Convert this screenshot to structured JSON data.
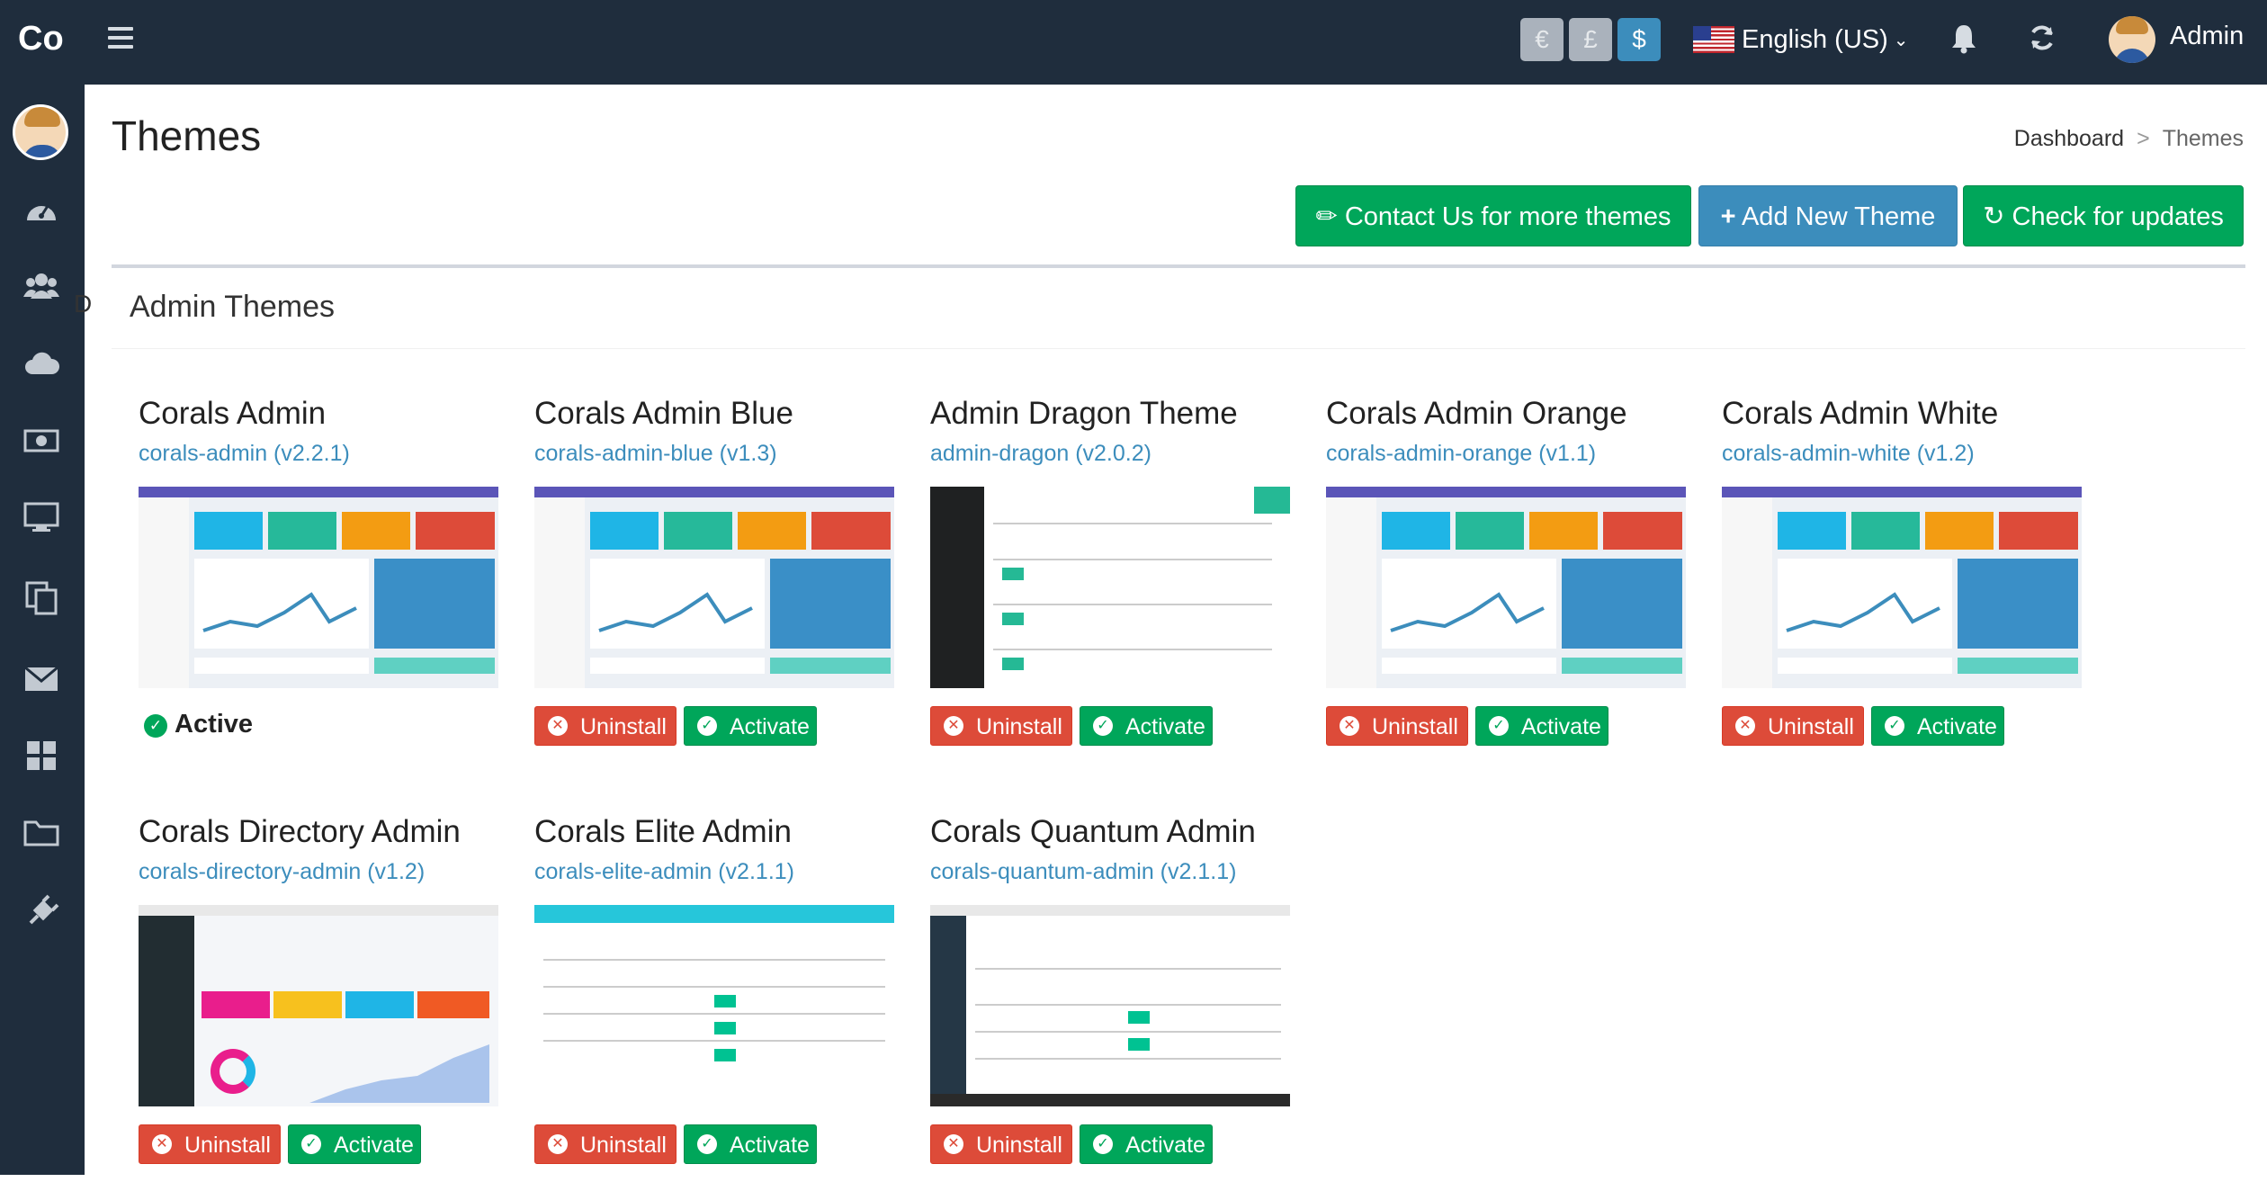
{
  "app": {
    "brand": "Co"
  },
  "topbar": {
    "currencies": [
      {
        "symbol": "€",
        "active": false
      },
      {
        "symbol": "£",
        "active": false
      },
      {
        "symbol": "$",
        "active": true
      }
    ],
    "language": "English (US)",
    "user_name": "Admin",
    "icons": [
      "menu-icon",
      "bell-icon",
      "refresh-icon",
      "avatar"
    ]
  },
  "sidebar": {
    "peek_label": "D",
    "icons": [
      "dashboard-icon",
      "users-icon",
      "cloud-icon",
      "money-icon",
      "desktop-icon",
      "copy-icon",
      "envelope-icon",
      "th-large-icon",
      "folder-icon",
      "plug-icon"
    ]
  },
  "page": {
    "title": "Themes",
    "breadcrumb": {
      "home": "Dashboard",
      "separator": ">",
      "current": "Themes"
    }
  },
  "header_buttons": {
    "contact": "Contact Us for more themes",
    "add": "Add New Theme",
    "check": "Check for updates"
  },
  "box": {
    "title": "Admin Themes"
  },
  "actions": {
    "uninstall": "Uninstall",
    "activate": "Activate",
    "active": "Active"
  },
  "themes": [
    {
      "name": "Corals Admin",
      "slug": "corals-admin (v2.2.1)",
      "active": true
    },
    {
      "name": "Corals Admin Blue",
      "slug": "corals-admin-blue (v1.3)",
      "active": false
    },
    {
      "name": "Admin Dragon Theme",
      "slug": "admin-dragon (v2.0.2)",
      "active": false
    },
    {
      "name": "Corals Admin Orange",
      "slug": "corals-admin-orange (v1.1)",
      "active": false
    },
    {
      "name": "Corals Admin White",
      "slug": "corals-admin-white (v1.2)",
      "active": false
    },
    {
      "name": "Corals Directory Admin",
      "slug": "corals-directory-admin (v1.2)",
      "active": false
    },
    {
      "name": "Corals Elite Admin",
      "slug": "corals-elite-admin (v2.1.1)",
      "active": false
    },
    {
      "name": "Corals Quantum Admin",
      "slug": "corals-quantum-admin (v2.1.1)",
      "active": false
    }
  ],
  "colors": {
    "navbar": "#1f2d3d",
    "primary": "#3c8dbc",
    "success": "#00a65a",
    "danger": "#dd4b39"
  }
}
